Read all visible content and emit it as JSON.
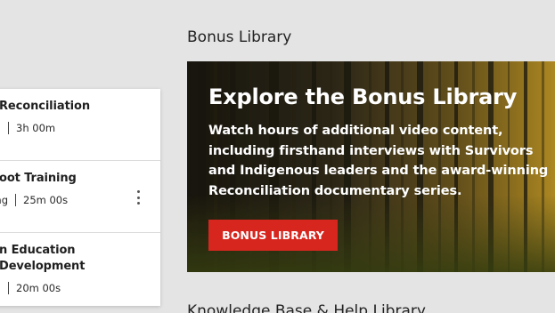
{
  "course_list": {
    "items": [
      {
        "title": "Reconciliation",
        "type": "",
        "duration": "3h 00m"
      },
      {
        "title": "oot Training",
        "type": "ng",
        "duration": "25m 00s"
      },
      {
        "title_lines": [
          "n Education",
          "Development"
        ],
        "type": "",
        "duration": "20m 00s"
      }
    ]
  },
  "bonus_library": {
    "heading": "Bonus Library",
    "banner": {
      "title": "Explore the Bonus Library",
      "description": "Watch hours of additional video content, including firsthand interviews with Survivors and Indigenous leaders and the award-winning Reconciliation documentary series.",
      "button_label": "BONUS LIBRARY",
      "button_color": "#d7261e"
    }
  },
  "knowledge_base": {
    "heading": "Knowledge Base & Help Library"
  },
  "icons": {
    "more_options": "kebab-menu-icon"
  }
}
